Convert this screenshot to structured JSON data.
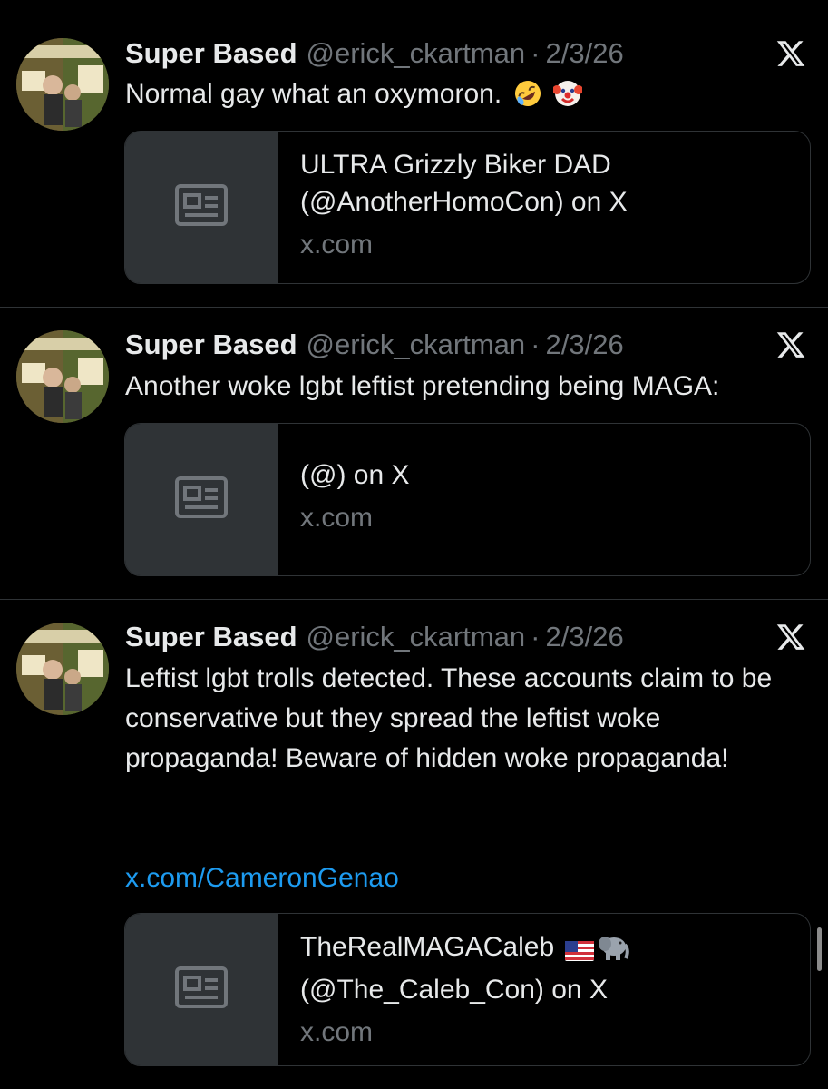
{
  "tweets": [
    {
      "display_name": "Super Based",
      "handle": "@erick_ckartman",
      "separator": "·",
      "date": "2/3/26",
      "text": "Normal gay what an oxymoron.",
      "emojis": [
        "rolling-on-floor-laughing-emoji",
        "clown-face-emoji"
      ],
      "card": {
        "title": "ULTRA Grizzly Biker DAD (@AnotherHomoCon) on X",
        "domain": "x.com"
      }
    },
    {
      "display_name": "Super Based",
      "handle": "@erick_ckartman",
      "separator": "·",
      "date": "2/3/26",
      "text": "Another woke lgbt leftist pretending being MAGA:",
      "card": {
        "title": "(@) on X",
        "domain": "x.com"
      }
    },
    {
      "display_name": "Super Based",
      "handle": "@erick_ckartman",
      "separator": "·",
      "date": "2/3/26",
      "text": "Leftist lgbt trolls detected. These accounts claim to be conservative but they spread the leftist woke propaganda! Beware of hidden woke propaganda!",
      "link": "x.com/CameronGenao",
      "card": {
        "title": "TheRealMAGACaleb",
        "title_emojis": [
          "us-flag-emoji",
          "elephant-emoji"
        ],
        "title_line2": "(@The_Caleb_Con) on X",
        "domain": "x.com"
      }
    }
  ],
  "icons": {
    "x_logo": "x-logo-icon",
    "card_thumb": "article-icon"
  },
  "colors": {
    "background": "#000000",
    "primary_text": "#e7e9ea",
    "secondary_text": "#71767b",
    "link": "#1d9bf0",
    "border": "#2f3336"
  }
}
